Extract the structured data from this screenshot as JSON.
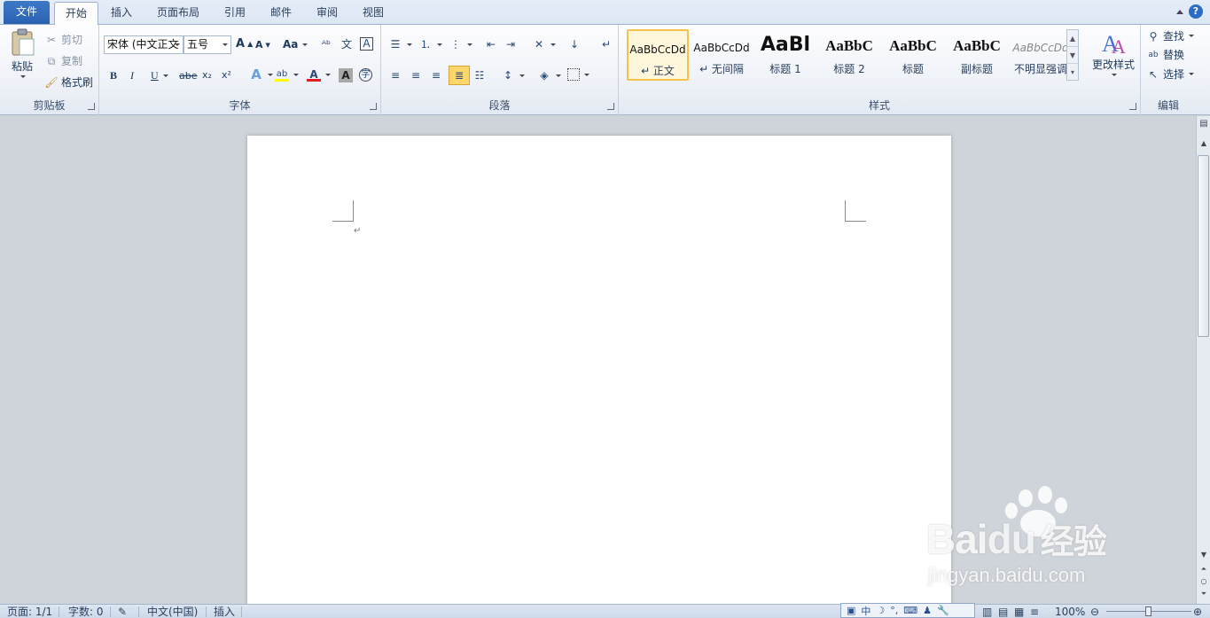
{
  "tabs": [
    "文件",
    "开始",
    "插入",
    "页面布局",
    "引用",
    "邮件",
    "审阅",
    "视图"
  ],
  "clipboard": {
    "paste": "粘贴",
    "cut": "剪切",
    "copy": "复制",
    "format_painter": "格式刷",
    "label": "剪贴板"
  },
  "font": {
    "name": "宋体 (中文正文",
    "size": "五号",
    "label": "字体",
    "bold": "B",
    "italic": "I",
    "underline": "U",
    "strike": "abe",
    "sub": "x₂",
    "sup": "x²",
    "change_case": "Aa",
    "grow": "A",
    "shrink": "A"
  },
  "paragraph": {
    "label": "段落"
  },
  "styles": {
    "label": "样式",
    "items": [
      {
        "sample": "AaBbCcDd",
        "name": "↵ 正文"
      },
      {
        "sample": "AaBbCcDd",
        "name": "↵ 无间隔"
      },
      {
        "sample": "AaBl",
        "name": "标题 1"
      },
      {
        "sample": "AaBbC",
        "name": "标题 2"
      },
      {
        "sample": "AaBbC",
        "name": "标题"
      },
      {
        "sample": "AaBbC",
        "name": "副标题"
      },
      {
        "sample": "AaBbCcDd",
        "name": "不明显强调"
      }
    ],
    "change_styles": "更改样式"
  },
  "editing": {
    "find": "查找",
    "replace": "替换",
    "select": "选择",
    "label": "编辑"
  },
  "document": {
    "para_mark": "↵"
  },
  "status": {
    "page": "页面: 1/1",
    "words": "字数: 0",
    "language": "中文(中国)",
    "mode": "插入",
    "zoom": "100%"
  },
  "ime": {
    "mode": "中"
  },
  "watermark": {
    "brand": "Bai",
    "brand2": "du",
    "cn": "经验",
    "url": "jingyan.baidu.com"
  },
  "colors": {
    "file_tab": "#2a62b0",
    "selected_style": "#f4c14d",
    "font_color": "#e02020",
    "highlight": "#ffff00"
  }
}
